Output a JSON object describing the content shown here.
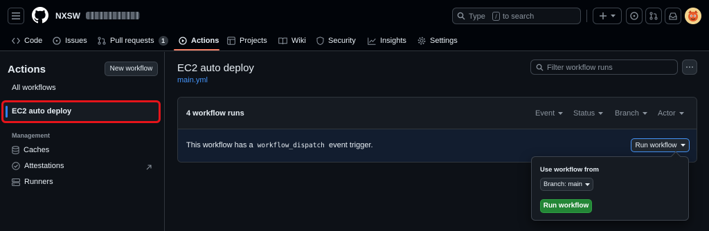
{
  "header": {
    "owner": "NXSW",
    "separator": "/",
    "search": {
      "before": "Type",
      "key": "/",
      "after": "to search"
    },
    "icons": [
      "menu-icon",
      "github-logo-icon",
      "search-icon",
      "plus-icon",
      "issue-opened-icon",
      "pull-request-icon",
      "inbox-icon"
    ]
  },
  "tabs": [
    {
      "label": "Code",
      "icon": "code-icon"
    },
    {
      "label": "Issues",
      "icon": "issue-opened-icon"
    },
    {
      "label": "Pull requests",
      "icon": "git-pull-request-icon",
      "count": "1"
    },
    {
      "label": "Actions",
      "icon": "play-icon",
      "active": true
    },
    {
      "label": "Projects",
      "icon": "table-icon"
    },
    {
      "label": "Wiki",
      "icon": "book-icon"
    },
    {
      "label": "Security",
      "icon": "shield-icon"
    },
    {
      "label": "Insights",
      "icon": "graph-icon"
    },
    {
      "label": "Settings",
      "icon": "gear-icon"
    }
  ],
  "sidebar": {
    "title": "Actions",
    "new_workflow": "New workflow",
    "all_workflows": "All workflows",
    "selected_workflow": "EC2 auto deploy",
    "section": "Management",
    "management": [
      {
        "label": "Caches",
        "icon": "database-icon"
      },
      {
        "label": "Attestations",
        "icon": "verified-icon"
      },
      {
        "label": "Runners",
        "icon": "server-icon"
      }
    ]
  },
  "main": {
    "title": "EC2 auto deploy",
    "file": "main.yml",
    "filter_placeholder": "Filter workflow runs",
    "runs_count": "4 workflow runs",
    "filters": [
      "Event",
      "Status",
      "Branch",
      "Actor"
    ],
    "dispatch_pre": "This workflow has a",
    "dispatch_code": "workflow_dispatch",
    "dispatch_post": "event trigger.",
    "run_workflow": "Run workflow"
  },
  "popover": {
    "label": "Use workflow from",
    "branch": "Branch: main",
    "run_button": "Run workflow"
  },
  "colors": {
    "accent_blue": "#4493f8",
    "active_tab_underline": "#f78166",
    "highlight_red": "#e5141a",
    "primary_green": "#238636",
    "background": "#0d1117"
  }
}
